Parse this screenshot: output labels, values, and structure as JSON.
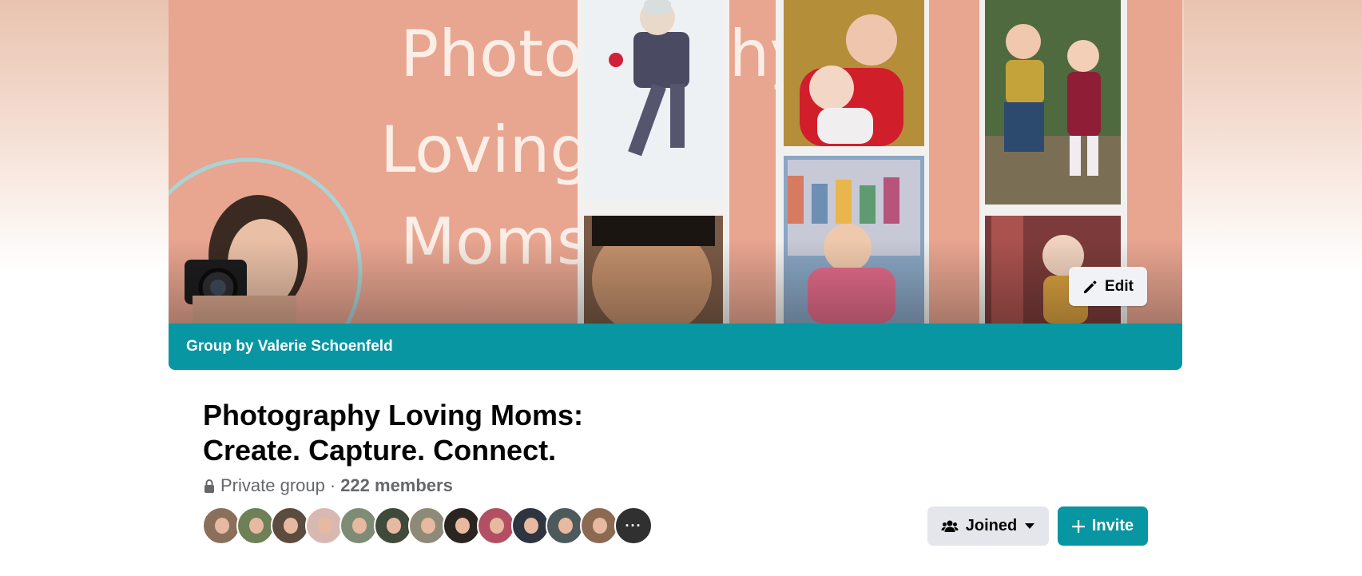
{
  "cover": {
    "title_lines": [
      "Photography",
      "Loving",
      "Moms"
    ],
    "banner_text": "Group by Valerie Schoenfeld",
    "edit_label": "Edit",
    "bg_color": "#e8a590",
    "banner_color": "#0796a2"
  },
  "group": {
    "title_line1": "Photography Loving Moms:",
    "title_line2": "Create. Capture. Connect.",
    "privacy": "Private group",
    "separator": "·",
    "members": "222 members"
  },
  "member_avatars": [
    {
      "icon": "avatar-photo",
      "color": "#8a6f5c"
    },
    {
      "icon": "avatar-photo",
      "color": "#6f7f58"
    },
    {
      "icon": "avatar-photo",
      "color": "#5c4b3f"
    },
    {
      "icon": "avatar-photo",
      "color": "#d8b9b2"
    },
    {
      "icon": "avatar-photo",
      "color": "#7e8c76"
    },
    {
      "icon": "avatar-photo",
      "color": "#3f4a3a"
    },
    {
      "icon": "avatar-photo",
      "color": "#8e8a78"
    },
    {
      "icon": "avatar-photo",
      "color": "#2b2522"
    },
    {
      "icon": "avatar-photo",
      "color": "#b34f63"
    },
    {
      "icon": "avatar-photo",
      "color": "#2e3440"
    },
    {
      "icon": "avatar-photo",
      "color": "#4d5a5c"
    },
    {
      "icon": "avatar-photo",
      "color": "#8c6a52"
    },
    {
      "icon": "more-members",
      "color": "#4b4b4b",
      "label": "···"
    }
  ],
  "actions": {
    "joined_label": "Joined",
    "invite_label": "Invite",
    "accent": "#0796a2"
  }
}
